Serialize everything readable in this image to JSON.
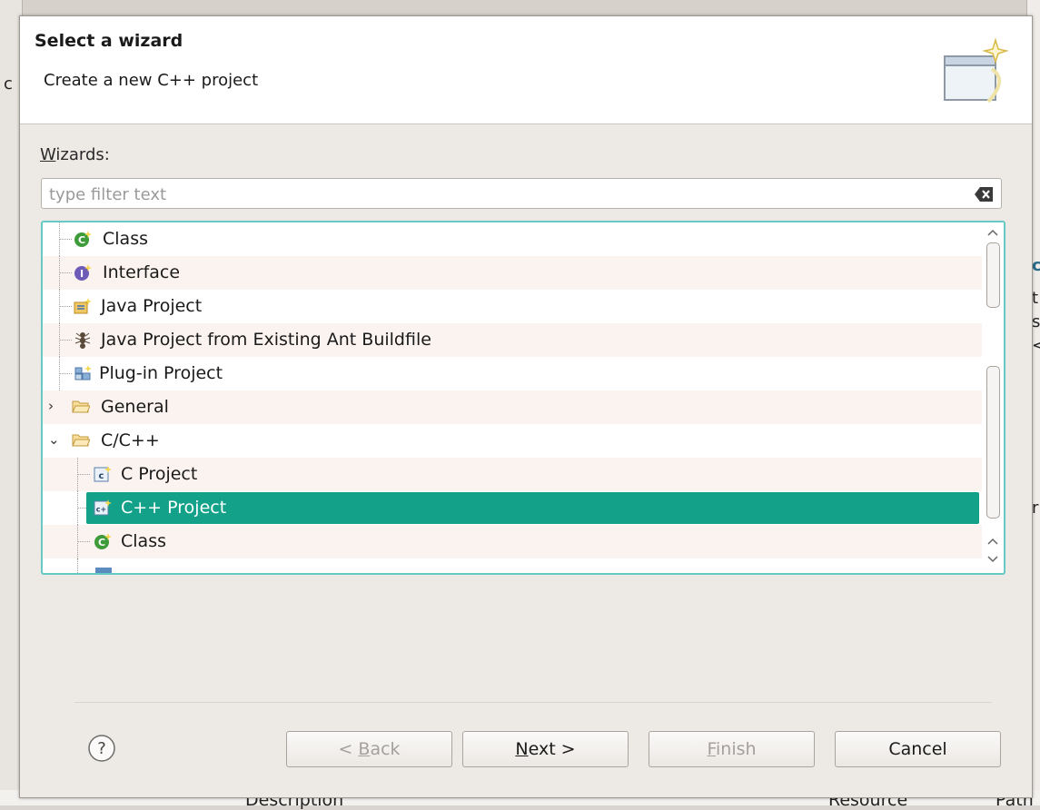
{
  "background": {
    "left_fragment": "c",
    "right_fragments": [
      "c",
      "t",
      "s",
      "<",
      "r"
    ],
    "bottom_left": "Description",
    "bottom_mid": "Resource",
    "bottom_right": "Path"
  },
  "banner": {
    "title": "Select a wizard",
    "subtitle": "Create a new C++ project",
    "icon": "new-wizard-icon"
  },
  "wizards_label": {
    "mnemonic": "W",
    "rest": "izards:"
  },
  "filter": {
    "placeholder": "type filter text",
    "value": "",
    "clear_icon": "clear-filter-icon"
  },
  "tree": {
    "items": [
      {
        "label": "Class",
        "icon": "java-class-icon",
        "depth": 1
      },
      {
        "label": "Interface",
        "icon": "java-interface-icon",
        "depth": 1
      },
      {
        "label": "Java Project",
        "icon": "java-project-icon",
        "depth": 1
      },
      {
        "label": "Java Project from Existing Ant Buildfile",
        "icon": "ant-icon",
        "depth": 1
      },
      {
        "label": "Plug-in Project",
        "icon": "plugin-project-icon",
        "depth": 1
      },
      {
        "label": "General",
        "icon": "folder-icon",
        "depth": 0,
        "expanded": false
      },
      {
        "label": "C/C++",
        "icon": "folder-icon",
        "depth": 0,
        "expanded": true
      },
      {
        "label": "C Project",
        "icon": "c-project-icon",
        "depth": 1
      },
      {
        "label": "C++ Project",
        "icon": "cpp-project-icon",
        "depth": 1,
        "selected": true
      },
      {
        "label": "Class",
        "icon": "cpp-class-icon",
        "depth": 1
      }
    ]
  },
  "buttons": {
    "help_icon": "help-icon",
    "back_mnemonic": "B",
    "back_prefix": "< ",
    "back_rest": "ack",
    "next_mnemonic": "N",
    "next_rest": "ext >",
    "finish_mnemonic": "F",
    "finish_rest": "inish",
    "cancel": "Cancel"
  }
}
